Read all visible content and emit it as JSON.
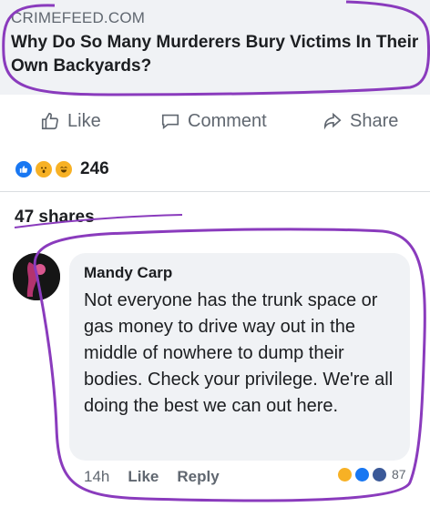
{
  "post": {
    "link_domain": "CRIMEFEED.COM",
    "link_title": "Why Do So Many Murderers Bury Victims In Their Own Backyards?"
  },
  "actions": {
    "like": "Like",
    "comment": "Comment",
    "share": "Share"
  },
  "reactions": {
    "icons": [
      "like-icon",
      "wow-icon",
      "haha-icon"
    ],
    "count": "246"
  },
  "shares": "47 shares",
  "comment": {
    "author": "Mandy Carp",
    "text": "Not everyone has the trunk space or gas money to drive way out in the middle of nowhere to dump their bodies. Check your privilege. We're all doing the best we can out here.",
    "time": "14h",
    "like": "Like",
    "reply": "Reply",
    "reaction_count": "87"
  },
  "colors": {
    "annotation": "#8a3bbd",
    "like_blue": "#1877f2",
    "reaction_yellow": "#f7b125"
  }
}
